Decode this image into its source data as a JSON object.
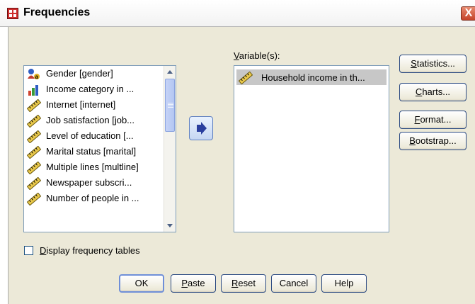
{
  "window": {
    "title": "Frequencies",
    "close_glyph": "X"
  },
  "source_list": {
    "items": [
      {
        "label": "Gender [gender]",
        "icon": "nominal-variable-icon"
      },
      {
        "label": "Income category in ...",
        "icon": "ordinal-variable-icon"
      },
      {
        "label": "Internet [internet]",
        "icon": "scale-variable-icon"
      },
      {
        "label": "Job satisfaction [job...",
        "icon": "scale-variable-icon"
      },
      {
        "label": "Level of education [...",
        "icon": "scale-variable-icon"
      },
      {
        "label": "Marital status [marital]",
        "icon": "scale-variable-icon"
      },
      {
        "label": "Multiple lines [multline]",
        "icon": "scale-variable-icon"
      },
      {
        "label": "Newspaper subscri...",
        "icon": "scale-variable-icon"
      },
      {
        "label": "Number of people in ...",
        "icon": "scale-variable-icon"
      }
    ]
  },
  "move_button": {
    "icon": "move-right-arrow-icon"
  },
  "variables": {
    "label_mnemonic": "V",
    "label_rest": "ariable(s):",
    "items": [
      {
        "label": "Household income in th...",
        "icon": "scale-variable-icon"
      }
    ]
  },
  "side_buttons": {
    "statistics": {
      "mnemonic": "S",
      "rest": "tatistics..."
    },
    "charts": {
      "mnemonic": "C",
      "rest": "harts..."
    },
    "format": {
      "mnemonic": "F",
      "rest": "ormat..."
    },
    "bootstrap": {
      "mnemonic": "B",
      "rest": "ootstrap..."
    }
  },
  "display_frequency": {
    "mnemonic": "D",
    "rest": "isplay frequency tables",
    "checked": false
  },
  "bottom_buttons": {
    "ok": "OK",
    "paste": {
      "mnemonic": "P",
      "rest": "aste"
    },
    "reset": {
      "mnemonic": "R",
      "rest": "eset"
    },
    "cancel": "Cancel",
    "help": "Help"
  },
  "colors": {
    "dialog_bg": "#ece9d8",
    "selection_bg": "#c7c7c7",
    "button_border": "#2b4a82",
    "arrow_blue": "#2a3f9e"
  }
}
